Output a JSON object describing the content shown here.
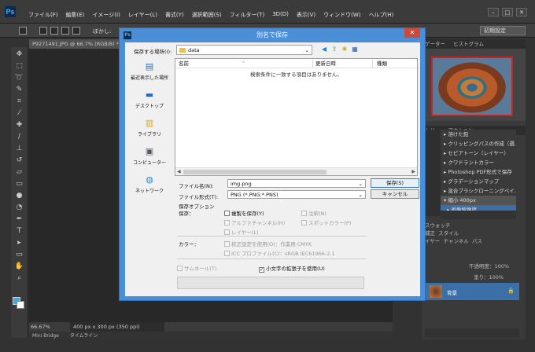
{
  "menubar": {
    "logo": "Ps",
    "items": [
      "ファイル(F)",
      "編集(E)",
      "イメージ(I)",
      "レイヤー(L)",
      "書式(Y)",
      "選択範囲(S)",
      "フィルター(T)",
      "3D(D)",
      "表示(V)",
      "ウィンドウ(W)",
      "ヘルプ(H)"
    ]
  },
  "options": {
    "blur_label": "ぼかし:",
    "preset": "初期設定"
  },
  "doc": {
    "tab": "P9271491.JPG @ 66.7% (RGB/8) *",
    "zoom": "66.67%",
    "info": "400 px x 300 px (350 ppi)"
  },
  "bottom_tabs": [
    "Mini Bridge",
    "タイムライン"
  ],
  "panels": {
    "nav_tabs": [
      "ゲーター",
      "ヒストグラム"
    ],
    "act_tabs": [
      "トリー",
      "アクション"
    ],
    "actions": [
      "溶けた鉛",
      "クリッピングパスの作成（選...",
      "セピアトーン（レイヤー）",
      "クワドラントカラー",
      "Photoshop PDF形式で保存",
      "グラデーションマップ",
      "混合ブラシクローニングペイ...",
      "縮小 400px",
      "画像解像度"
    ],
    "layer_tabs1": [
      "スウォッチ"
    ],
    "layer_tabs2": [
      "補正",
      "スタイル"
    ],
    "layer_tabs3": [
      "イヤー",
      "チャンネル",
      "パス"
    ],
    "layer_opacity": "不透明度：100%",
    "layer_fill": "塗り：100%",
    "layer_name": "背景"
  },
  "dialog": {
    "title": "別名で保存",
    "save_in_label": "保存する場所(I):",
    "folder": "data",
    "places": [
      "最近表示した場所",
      "デスクトップ",
      "ライブラリ",
      "コンピューター",
      "ネットワーク"
    ],
    "columns": {
      "name": "名前",
      "date": "更新日時",
      "type": "種類"
    },
    "empty_message": "検索条件に一致する項目はありません。",
    "filename_label": "ファイル名(N):",
    "filename": "img.png",
    "format_label": "ファイル形式(T):",
    "format": "PNG (*.PNG;*.PNS)",
    "save_button": "保存(S)",
    "cancel_button": "キャンセル",
    "save_options_heading": "保存オプション",
    "save_label": "保存：",
    "opt_copy": "複製を保存(Y)",
    "opt_notes": "注釈(N)",
    "opt_alpha": "アルファチャンネル(H)",
    "opt_spot": "スポットカラー(P)",
    "opt_layers": "レイヤー(L)",
    "color_label": "カラー：",
    "opt_proof": "校正設定を使用(O)：作業用 CMYK",
    "opt_icc": "ICC プロファイル(C)：sRGB IEC61966-2.1",
    "opt_thumb": "サムネール(T)",
    "opt_lowercase": "小文字の拡張子を使用(U)"
  }
}
